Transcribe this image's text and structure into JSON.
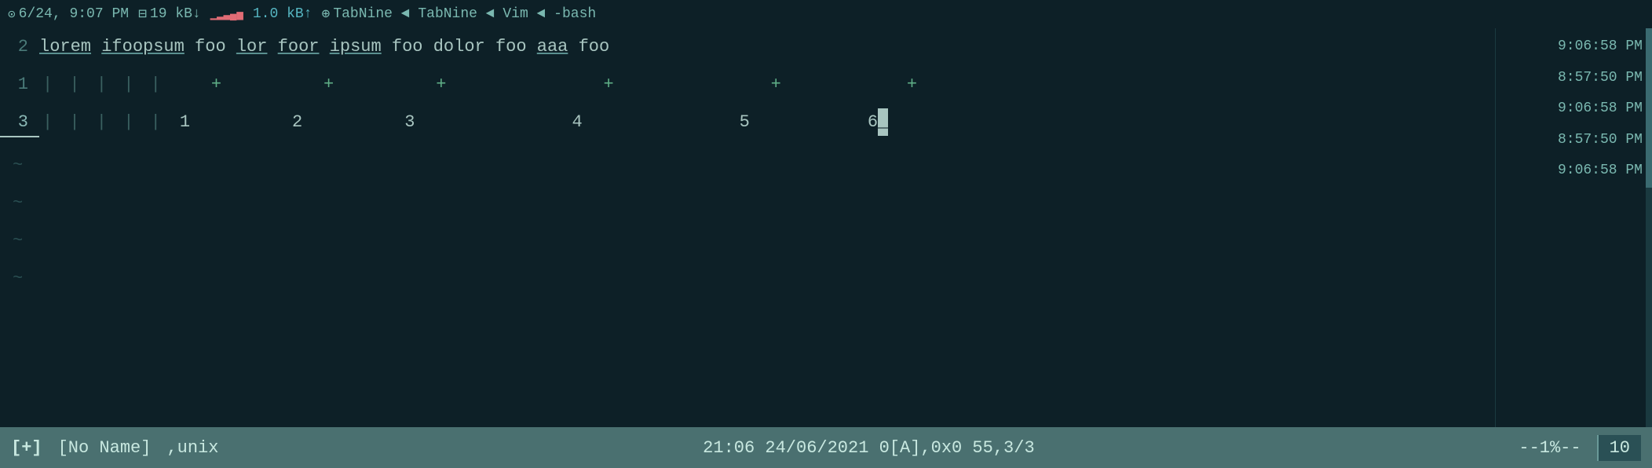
{
  "topbar": {
    "clock_icon": "⊙",
    "date_time": "6/24, 9:07 PM",
    "net_icon": "⊟",
    "net_down": "19 kB↓",
    "net_bars": "▁▂▃▄▅",
    "net_up": "1.0 kB↑",
    "tabnine_icon": "⊕",
    "tabnine_label": "TabNine ◄ TabNine ◄ Vim ◄ -bash"
  },
  "right_times": [
    "9:06:58 PM",
    "8:57:50 PM",
    "9:06:58 PM",
    "8:57:50 PM",
    "9:06:58 PM"
  ],
  "lines": [
    {
      "number": "2",
      "tokens": [
        "lorem",
        " ",
        "ifoopsum",
        " ",
        "foo",
        " ",
        "lor",
        " ",
        "foor",
        " ",
        "ipsum",
        " ",
        "foo",
        " ",
        "dolor",
        " ",
        "foo",
        " ",
        "aaa",
        " ",
        "foo"
      ]
    },
    {
      "number": "1",
      "separators": [
        "|",
        "|",
        "|",
        "|",
        "|"
      ],
      "plus_signs": [
        "+",
        "+",
        "+",
        "+",
        "+",
        "+"
      ]
    },
    {
      "number": "3",
      "separators": [
        "|",
        "|",
        "|",
        "|",
        "|"
      ],
      "numbers": [
        "1",
        "2",
        "3",
        "4",
        "5",
        "6"
      ]
    }
  ],
  "tildes": [
    "~",
    "~",
    "~",
    "~"
  ],
  "statusbar": {
    "modified": "[+]",
    "filename": "[No Name]",
    "format": ",unix",
    "middle": "21:06  24/06/2021  0[A],0x0  55,3/3",
    "scroll_pct": "--1%--",
    "tab_num": "10"
  }
}
